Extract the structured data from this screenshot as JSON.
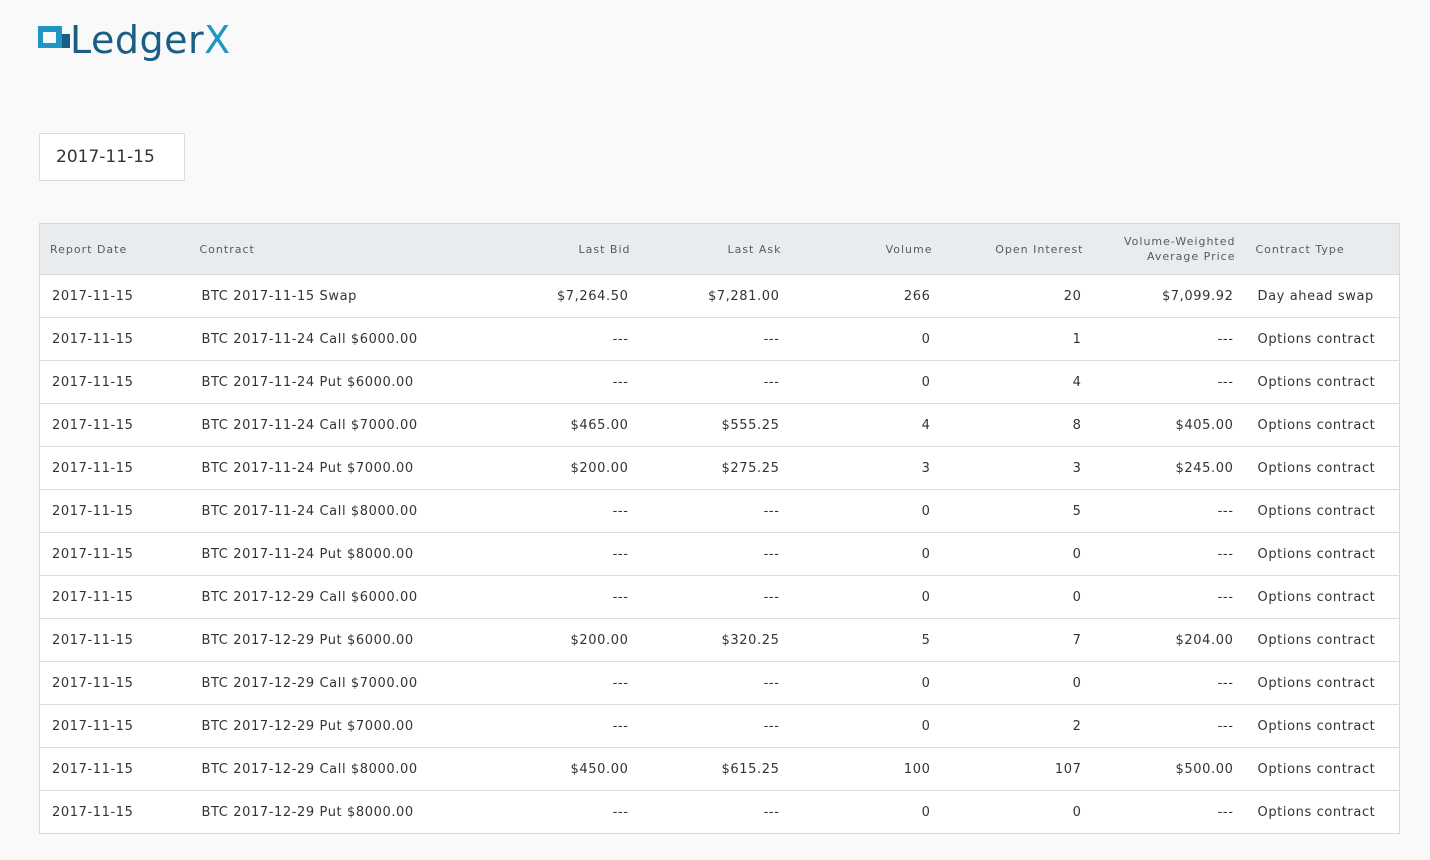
{
  "brand": {
    "name_main": "Ledger",
    "name_accent": "X",
    "colors": {
      "dark": "#1a5e84",
      "accent": "#1f97c4"
    }
  },
  "date_filter": {
    "value": "2017-11-15"
  },
  "table": {
    "headers": {
      "report_date": "Report Date",
      "contract": "Contract",
      "last_bid": "Last Bid",
      "last_ask": "Last Ask",
      "volume": "Volume",
      "open_interest": "Open Interest",
      "vwap_line1": "Volume-Weighted",
      "vwap_line2": "Average Price",
      "contract_type": "Contract Type"
    },
    "rows": [
      {
        "report_date": "2017-11-15",
        "contract": "BTC 2017-11-15 Swap",
        "last_bid": "$7,264.50",
        "last_ask": "$7,281.00",
        "volume": "266",
        "open_interest": "20",
        "vwap": "$7,099.92",
        "contract_type": "Day ahead swap"
      },
      {
        "report_date": "2017-11-15",
        "contract": "BTC 2017-11-24 Call $6000.00",
        "last_bid": "---",
        "last_ask": "---",
        "volume": "0",
        "open_interest": "1",
        "vwap": "---",
        "contract_type": "Options contract"
      },
      {
        "report_date": "2017-11-15",
        "contract": "BTC 2017-11-24 Put $6000.00",
        "last_bid": "---",
        "last_ask": "---",
        "volume": "0",
        "open_interest": "4",
        "vwap": "---",
        "contract_type": "Options contract"
      },
      {
        "report_date": "2017-11-15",
        "contract": "BTC 2017-11-24 Call $7000.00",
        "last_bid": "$465.00",
        "last_ask": "$555.25",
        "volume": "4",
        "open_interest": "8",
        "vwap": "$405.00",
        "contract_type": "Options contract"
      },
      {
        "report_date": "2017-11-15",
        "contract": "BTC 2017-11-24 Put $7000.00",
        "last_bid": "$200.00",
        "last_ask": "$275.25",
        "volume": "3",
        "open_interest": "3",
        "vwap": "$245.00",
        "contract_type": "Options contract"
      },
      {
        "report_date": "2017-11-15",
        "contract": "BTC 2017-11-24 Call $8000.00",
        "last_bid": "---",
        "last_ask": "---",
        "volume": "0",
        "open_interest": "5",
        "vwap": "---",
        "contract_type": "Options contract"
      },
      {
        "report_date": "2017-11-15",
        "contract": "BTC 2017-11-24 Put $8000.00",
        "last_bid": "---",
        "last_ask": "---",
        "volume": "0",
        "open_interest": "0",
        "vwap": "---",
        "contract_type": "Options contract"
      },
      {
        "report_date": "2017-11-15",
        "contract": "BTC 2017-12-29 Call $6000.00",
        "last_bid": "---",
        "last_ask": "---",
        "volume": "0",
        "open_interest": "0",
        "vwap": "---",
        "contract_type": "Options contract"
      },
      {
        "report_date": "2017-11-15",
        "contract": "BTC 2017-12-29 Put $6000.00",
        "last_bid": "$200.00",
        "last_ask": "$320.25",
        "volume": "5",
        "open_interest": "7",
        "vwap": "$204.00",
        "contract_type": "Options contract"
      },
      {
        "report_date": "2017-11-15",
        "contract": "BTC 2017-12-29 Call $7000.00",
        "last_bid": "---",
        "last_ask": "---",
        "volume": "0",
        "open_interest": "0",
        "vwap": "---",
        "contract_type": "Options contract"
      },
      {
        "report_date": "2017-11-15",
        "contract": "BTC 2017-12-29 Put $7000.00",
        "last_bid": "---",
        "last_ask": "---",
        "volume": "0",
        "open_interest": "2",
        "vwap": "---",
        "contract_type": "Options contract"
      },
      {
        "report_date": "2017-11-15",
        "contract": "BTC 2017-12-29 Call $8000.00",
        "last_bid": "$450.00",
        "last_ask": "$615.25",
        "volume": "100",
        "open_interest": "107",
        "vwap": "$500.00",
        "contract_type": "Options contract"
      },
      {
        "report_date": "2017-11-15",
        "contract": "BTC 2017-12-29 Put $8000.00",
        "last_bid": "---",
        "last_ask": "---",
        "volume": "0",
        "open_interest": "0",
        "vwap": "---",
        "contract_type": "Options contract"
      }
    ]
  }
}
